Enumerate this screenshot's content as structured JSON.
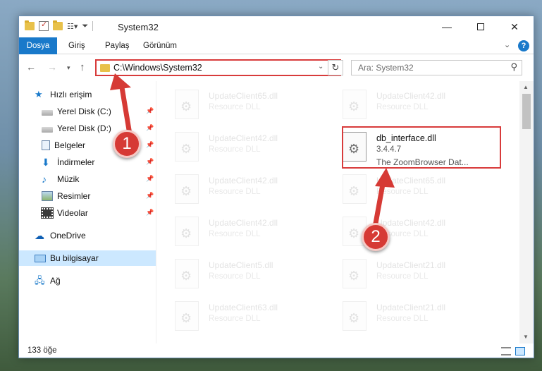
{
  "window": {
    "title": "System32",
    "quick_access_toolbar": [
      "folder-icon",
      "properties-icon",
      "new-folder-icon",
      "view-icon"
    ],
    "controls": {
      "minimize": "—",
      "maximize": "",
      "close": "✕"
    }
  },
  "ribbon": {
    "tabs": [
      "Dosya",
      "Giriş",
      "Paylaş",
      "Görünüm"
    ],
    "expand_glyph": "⌄",
    "help_glyph": "?"
  },
  "nav": {
    "back": "←",
    "forward": "→",
    "recent": "▾",
    "up": "↑",
    "address": "C:\\Windows\\System32",
    "address_drop": "⌄",
    "refresh": "↻",
    "search_placeholder": "Ara: System32",
    "search_glyph": "⚲"
  },
  "sidebar": {
    "quick_access": "Hızlı erişim",
    "items": [
      {
        "label": "Yerel Disk (C:)",
        "icon": "disk-icon",
        "pinned": true
      },
      {
        "label": "Yerel Disk (D:)",
        "icon": "disk-icon",
        "pinned": true
      },
      {
        "label": "Belgeler",
        "icon": "documents-icon",
        "pinned": true
      },
      {
        "label": "İndirmeler",
        "icon": "downloads-icon",
        "pinned": true
      },
      {
        "label": "Müzik",
        "icon": "music-icon",
        "pinned": true
      },
      {
        "label": "Resimler",
        "icon": "pictures-icon",
        "pinned": true
      },
      {
        "label": "Videolar",
        "icon": "videos-icon",
        "pinned": true
      }
    ],
    "onedrive": "OneDrive",
    "this_pc": "Bu bilgisayar",
    "network": "Ağ",
    "pin_glyph": "📌"
  },
  "files": [
    {
      "name": "UpdateClient65.dll",
      "type": "Resource DLL"
    },
    {
      "name": "UpdateClient42.dll",
      "type": "Resource DLL"
    },
    {
      "name": "UpdateClient42.dll",
      "type": "Resource DLL"
    },
    {
      "name": "db_interface.dll",
      "type": "3.4.4.7",
      "description": "The ZoomBrowser Dat...",
      "highlighted": true
    },
    {
      "name": "UpdateClient42.dll",
      "type": "Resource DLL"
    },
    {
      "name": "UpdateClient65.dll",
      "type": "Resource DLL"
    },
    {
      "name": "UpdateClient42.dll",
      "type": "Resource DLL"
    },
    {
      "name": "UpdateClient42.dll",
      "type": "Resource DLL"
    },
    {
      "name": "UpdateClient5.dll",
      "type": "Resource DLL"
    },
    {
      "name": "UpdateClient21.dll",
      "type": "Resource DLL"
    },
    {
      "name": "UpdateClient63.dll",
      "type": "Resource DLL"
    },
    {
      "name": "UpdateClient21.dll",
      "type": "Resource DLL"
    }
  ],
  "status": {
    "count": "133 öğe"
  },
  "annotations": {
    "step1": "1",
    "step2": "2",
    "arrow_color": "#d63a35"
  }
}
